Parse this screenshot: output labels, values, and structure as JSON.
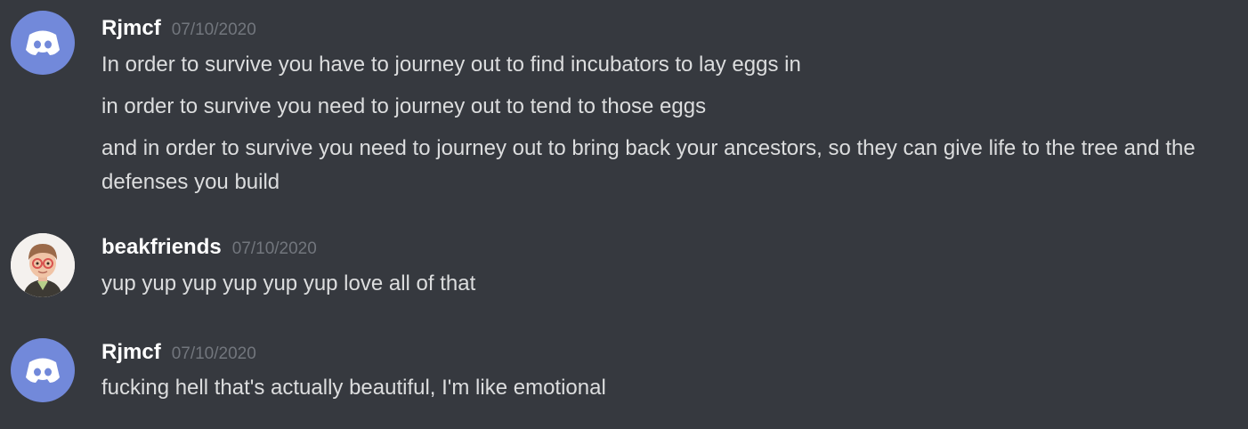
{
  "colors": {
    "background": "#36393f",
    "discord_blurple": "#7289da",
    "username": "#ffffff",
    "timestamp": "#72767d",
    "message_text": "#dcddde"
  },
  "messages": [
    {
      "author": "Rjmcf",
      "timestamp": "07/10/2020",
      "avatar_icon": "discord-default-avatar-icon",
      "lines": [
        "In order to survive you have to journey out to find incubators to lay eggs in",
        "in order to survive you need to journey out to tend to those eggs",
        "and in order to survive you need to journey out to bring back your ancestors, so they can give life to the tree and the defenses you build"
      ]
    },
    {
      "author": "beakfriends",
      "timestamp": "07/10/2020",
      "avatar_icon": "user-avatar-icon",
      "lines": [
        "yup yup yup yup yup yup love all of that"
      ]
    },
    {
      "author": "Rjmcf",
      "timestamp": "07/10/2020",
      "avatar_icon": "discord-default-avatar-icon",
      "lines": [
        "fucking hell that's actually beautiful, I'm like emotional"
      ]
    }
  ]
}
